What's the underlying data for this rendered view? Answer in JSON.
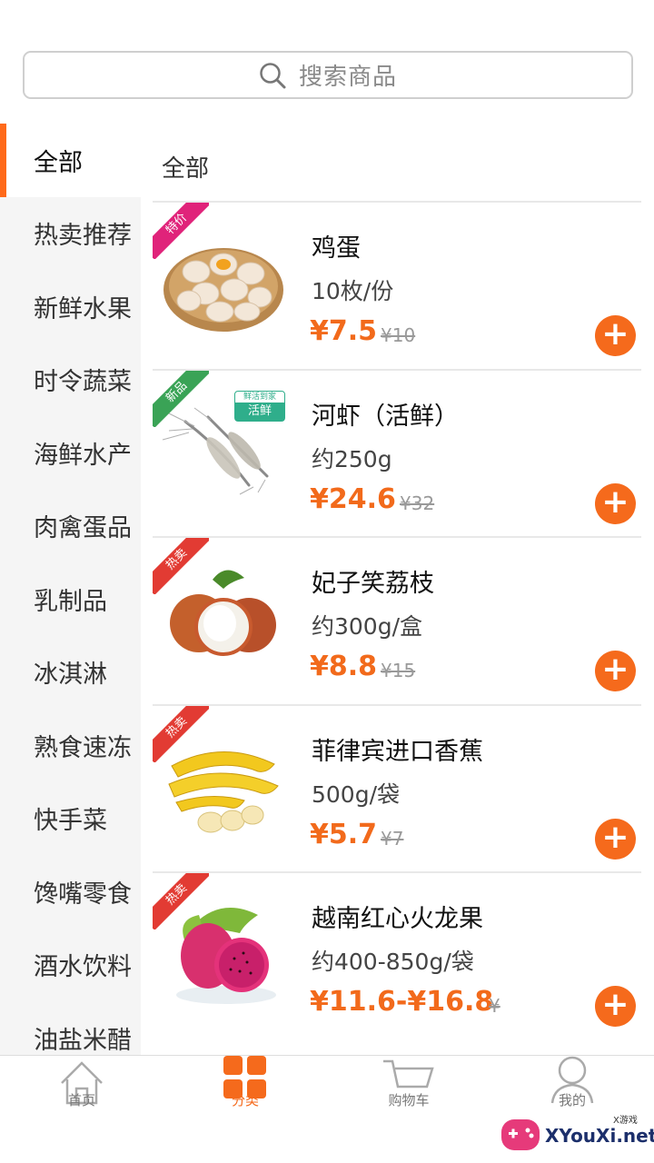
{
  "search": {
    "placeholder": "搜索商品"
  },
  "sidebar": {
    "items": [
      {
        "label": "全部",
        "active": true
      },
      {
        "label": "热卖推荐"
      },
      {
        "label": "新鲜水果"
      },
      {
        "label": "时令蔬菜"
      },
      {
        "label": "海鲜水产"
      },
      {
        "label": "肉禽蛋品"
      },
      {
        "label": "乳制品"
      },
      {
        "label": "冰淇淋"
      },
      {
        "label": "熟食速冻"
      },
      {
        "label": "快手菜"
      },
      {
        "label": "馋嘴零食"
      },
      {
        "label": "酒水饮料"
      },
      {
        "label": "油盐米醋"
      }
    ]
  },
  "content": {
    "title": "全部"
  },
  "products": [
    {
      "name": "鸡蛋",
      "spec": "10枚/份",
      "price": "¥7.5",
      "old_price": "¥10",
      "tag": "特价",
      "tag_color": "#e0237a",
      "image": "eggs-basket"
    },
    {
      "name": "河虾（活鲜）",
      "spec": "约250g",
      "price": "¥24.6",
      "old_price": "¥32",
      "tag": "新品",
      "tag_color": "#3aa356",
      "image": "river-shrimp",
      "badge_top": "鲜活到家",
      "badge_bottom": "活鲜"
    },
    {
      "name": "妃子笑荔枝",
      "spec": "约300g/盒",
      "price": "¥8.8",
      "old_price": "¥15",
      "tag": "热卖",
      "tag_color": "#e23b33",
      "image": "lychee"
    },
    {
      "name": "菲律宾进口香蕉",
      "spec": "500g/袋",
      "price": "¥5.7",
      "old_price": "¥7",
      "tag": "热卖",
      "tag_color": "#e23b33",
      "image": "banana"
    },
    {
      "name": "越南红心火龙果",
      "spec": "约400-850g/袋",
      "price": "¥11.6-¥16.8",
      "old_price": "¥",
      "tag": "热卖",
      "tag_color": "#e23b33",
      "image": "dragon-fruit"
    }
  ],
  "add_label": "+",
  "tabbar": {
    "items": [
      {
        "label": "首页",
        "icon": "home-icon"
      },
      {
        "label": "分类",
        "icon": "category-grid-icon",
        "active": true
      },
      {
        "label": "购物车",
        "icon": "cart-icon"
      },
      {
        "label": "我的",
        "icon": "user-icon"
      }
    ]
  },
  "watermark": {
    "text": "XYouXi.net",
    "small": "X游戏"
  },
  "colors": {
    "accent": "#f56a1c",
    "sidebar_bg": "#f5f5f5"
  }
}
